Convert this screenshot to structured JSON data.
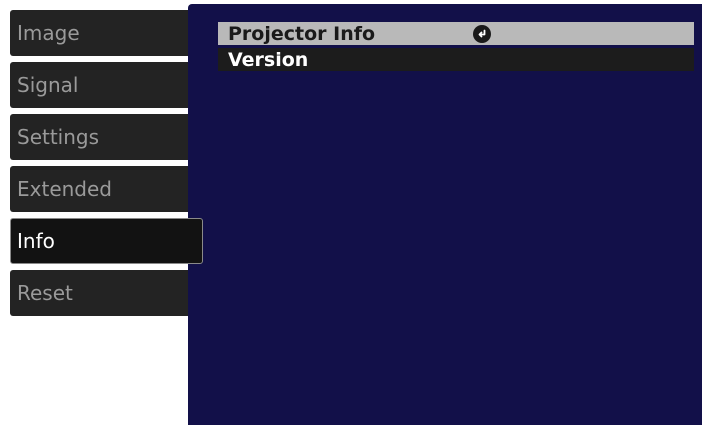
{
  "sidebar": {
    "tabs": [
      {
        "label": "Image"
      },
      {
        "label": "Signal"
      },
      {
        "label": "Settings"
      },
      {
        "label": "Extended"
      },
      {
        "label": "Info"
      },
      {
        "label": "Reset"
      }
    ],
    "active_tab": "Info"
  },
  "content": {
    "items": [
      {
        "label": "Projector Info",
        "icon": "enter-icon"
      },
      {
        "label": "Version"
      }
    ],
    "selected_item": "Projector Info"
  },
  "colors": {
    "content_background": "#121049",
    "tab_background": "#232323",
    "selected_row": "#b9b9b9",
    "row_background": "#1c1c1c"
  }
}
